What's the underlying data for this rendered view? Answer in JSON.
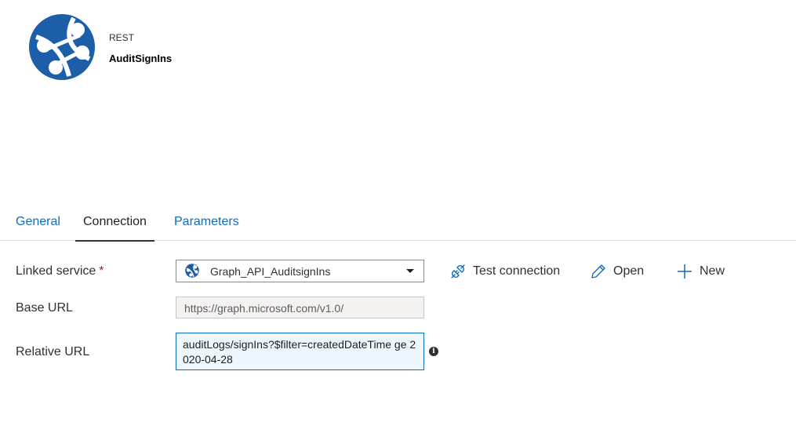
{
  "dataset": {
    "type": "REST",
    "name": "AuditSignIns"
  },
  "tabs": [
    {
      "label": "General",
      "active": false
    },
    {
      "label": "Connection",
      "active": true
    },
    {
      "label": "Parameters",
      "active": false
    }
  ],
  "connection": {
    "linked_service": {
      "label": "Linked service",
      "required_marker": "*",
      "value": "Graph_API_AuditsignIns"
    },
    "actions": {
      "test_connection": "Test connection",
      "open": "Open",
      "new": "New"
    },
    "base_url": {
      "label": "Base URL",
      "value": "https://graph.microsoft.com/v1.0/"
    },
    "relative_url": {
      "label": "Relative URL",
      "value": "auditLogs/signIns?$filter=createdDateTime ge 2020-04-28"
    },
    "info_glyph": "i"
  },
  "colors": {
    "brand_blue": "#1d5ea8",
    "link_blue": "#0f6cbd",
    "required_red": "#a4262c"
  }
}
